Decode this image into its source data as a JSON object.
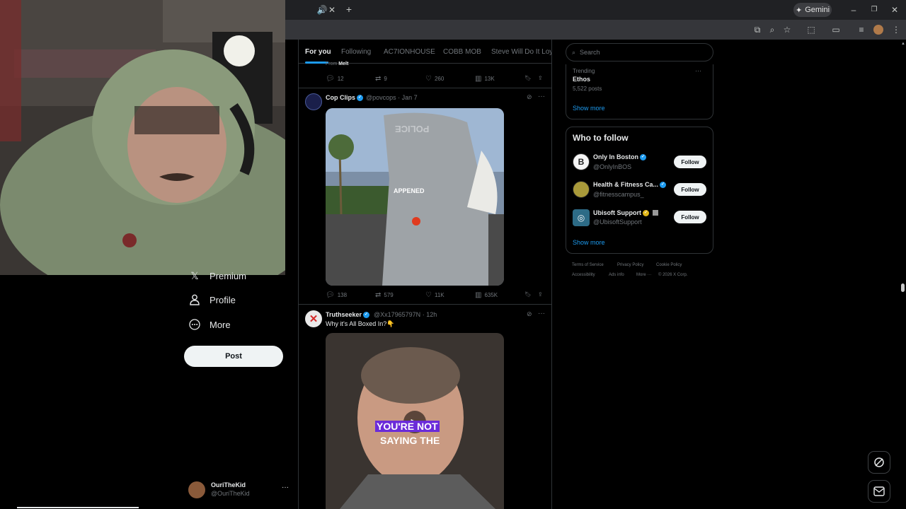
{
  "browser": {
    "tab_audio_icon": "speaker-icon",
    "gemini_label": "Gemini",
    "window_controls": [
      "minimize-icon",
      "restore-icon",
      "close-icon"
    ]
  },
  "nav": {
    "items": [
      {
        "label": "Premium",
        "icon": "x-logo-icon"
      },
      {
        "label": "Profile",
        "icon": "person-icon"
      },
      {
        "label": "More",
        "icon": "more-circle-icon"
      }
    ],
    "post_label": "Post",
    "account": {
      "name": "OuriTheKid",
      "handle": "@OuriTheKid"
    }
  },
  "feed": {
    "tabs": [
      "For you",
      "Following",
      "AC7IONHOUSE",
      "COBB MOB",
      "Steve Will Do It Loyal"
    ],
    "from_prefix": "From",
    "from_name": "Melt",
    "top_stats": {
      "replies": "12",
      "reposts": "9",
      "likes": "260",
      "views": "13K"
    },
    "tweets": [
      {
        "name": "Cop Clips",
        "handle": "@povcops",
        "date": "Jan 7",
        "media_caption": "POLICE",
        "media_overlay": "APPENED",
        "stats": {
          "replies": "138",
          "reposts": "579",
          "likes": "11K",
          "views": "635K"
        }
      },
      {
        "name": "Truthseeker",
        "handle": "@Xx17965797N",
        "date": "12h",
        "text": "Why it's All Boxed In?👇",
        "caption_line1": "YOU'RE NOT",
        "caption_line2": "SAYING THE"
      }
    ]
  },
  "sidebar": {
    "search_placeholder": "Search",
    "trending": {
      "label": "Trending",
      "topic": "Ethos",
      "count": "5,522 posts",
      "show_more": "Show more"
    },
    "who_to_follow": {
      "title": "Who to follow",
      "follow_label": "Follow",
      "show_more": "Show more",
      "accounts": [
        {
          "name": "Only In Boston",
          "handle": "@OnlyInBOS"
        },
        {
          "name": "Health & Fitness Ca...",
          "handle": "@fitnesscampus_"
        },
        {
          "name": "Ubisoft Support",
          "handle": "@UbisoftSupport"
        }
      ]
    },
    "footer": {
      "links": [
        "Terms of Service",
        "Privacy Policy",
        "Cookie Policy",
        "Accessibility",
        "Ads info",
        "More ···"
      ],
      "copyright": "© 2026 X Corp."
    }
  },
  "colors": {
    "accent": "#1d9bf0",
    "background": "#000000",
    "border": "#2f3336",
    "muted": "#71767b"
  }
}
